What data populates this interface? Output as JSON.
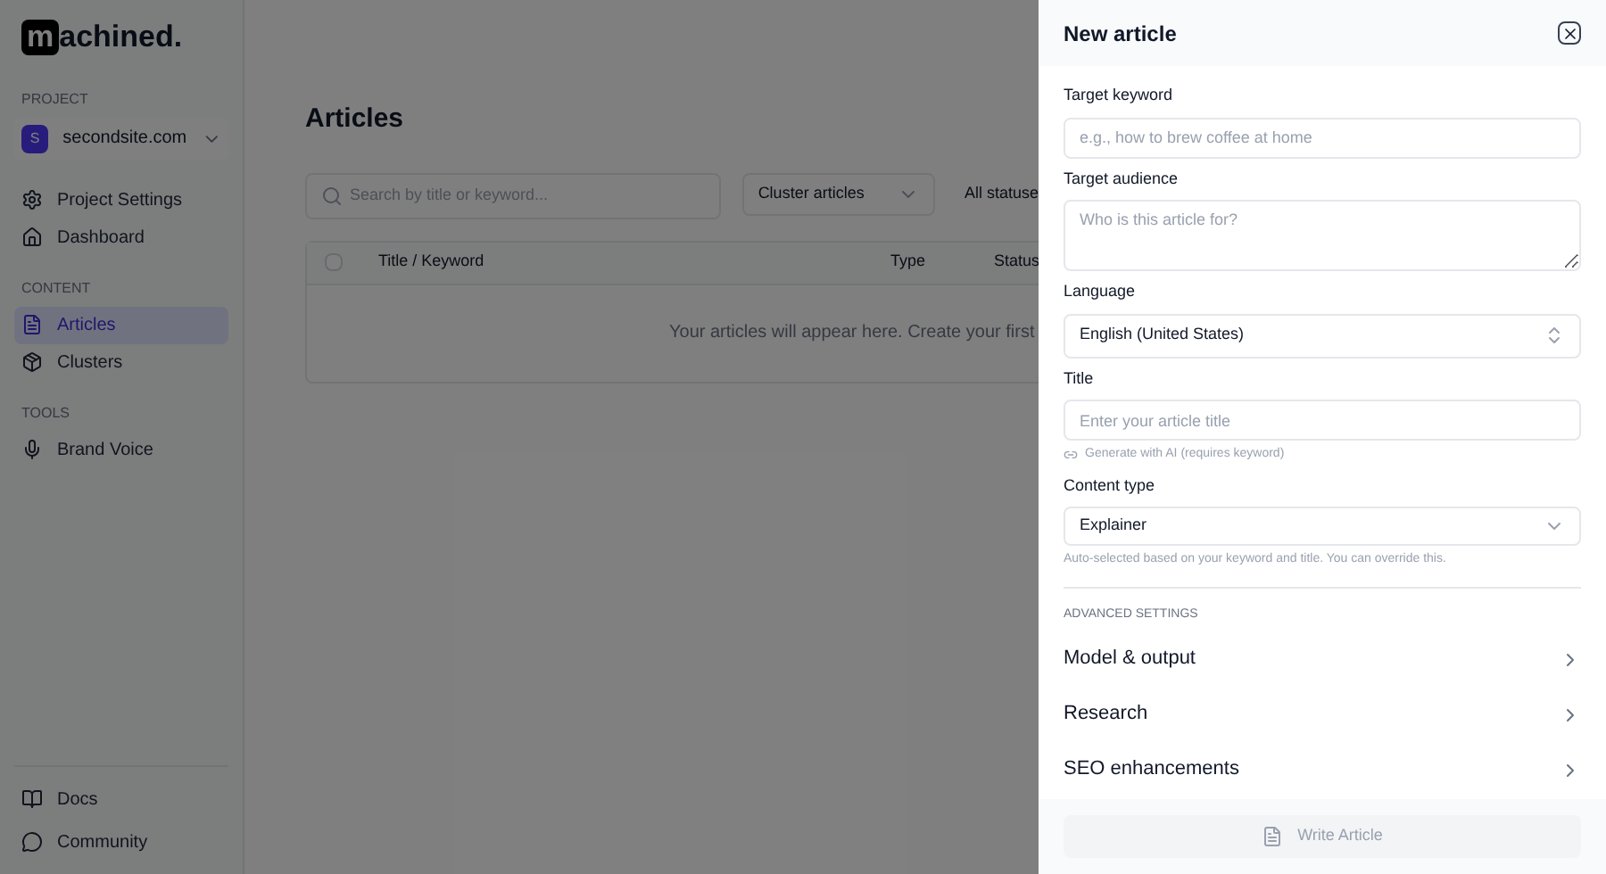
{
  "logo": {
    "mark": "m",
    "text": "achined."
  },
  "sidebar": {
    "project_label": "PROJECT",
    "project": {
      "initial": "S",
      "name": "secondsite.com"
    },
    "sections": [
      {
        "items": [
          {
            "label": "Project Settings",
            "selected": false
          },
          {
            "label": "Dashboard",
            "selected": false
          }
        ]
      },
      {
        "label": "CONTENT",
        "items": [
          {
            "label": "Articles",
            "selected": true
          },
          {
            "label": "Clusters",
            "selected": false
          }
        ]
      },
      {
        "label": "TOOLS",
        "items": [
          {
            "label": "Brand Voice",
            "selected": false
          }
        ]
      }
    ],
    "footer": [
      {
        "label": "Docs"
      },
      {
        "label": "Community"
      }
    ]
  },
  "main": {
    "title": "Articles",
    "search": {
      "placeholder": "Search by title or keyword..."
    },
    "cluster_filter": "Cluster articles",
    "status_filter": "All statuse",
    "table": {
      "select_all_checked": false,
      "columns": [
        "Title / Keyword",
        "Type",
        "Status"
      ],
      "empty": "Your articles will appear here. Create your first"
    }
  },
  "drawer": {
    "title": "New article",
    "fields": [
      {
        "kind": "input",
        "label": "Target keyword",
        "placeholder": "e.g., how to brew coffee at home"
      },
      {
        "kind": "textarea",
        "label": "Target audience",
        "placeholder": "Who is this article for?"
      },
      {
        "kind": "select",
        "label": "Language",
        "value": "English (United States)"
      },
      {
        "kind": "input",
        "label": "Title",
        "placeholder": "Enter your article title",
        "hint": "Generate with AI (requires keyword)"
      },
      {
        "kind": "dropdown",
        "label": "Content type",
        "value": "Explainer",
        "hint": "Auto-selected based on your keyword and title. You can override this."
      }
    ],
    "advanced_label": "ADVANCED SETTINGS",
    "sections": [
      "Model & output",
      "Research",
      "SEO enhancements"
    ],
    "submit": {
      "label": "Write Article",
      "disabled": true
    }
  }
}
